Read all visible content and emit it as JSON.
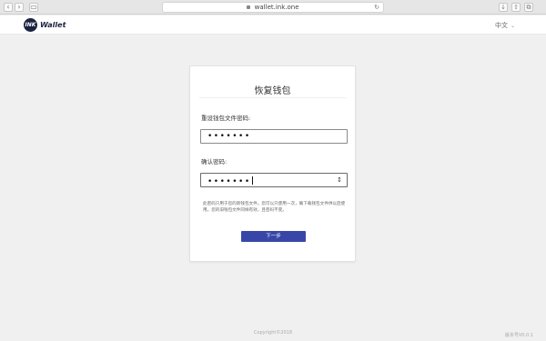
{
  "browser": {
    "url": "wallet.ink.one",
    "back": "‹",
    "forward": "›",
    "sidebar": "▭",
    "reload": "↻",
    "share": "⇧",
    "tabs": "⧉",
    "download": "↓",
    "icons": [
      "lock-icon",
      "reload-icon",
      "share-icon",
      "tabs-icon",
      "download-icon"
    ]
  },
  "header": {
    "logo_mark": "INK",
    "logo_text": "Wallet",
    "language": "中文",
    "chevron": "⌄"
  },
  "card": {
    "title": "恢复钱包",
    "reset_label": "重设钱包文件密码:",
    "reset_value": "•••••••",
    "confirm_label": "确认密码:",
    "confirm_value": "•••••••",
    "eye_icon_glyph": "👁",
    "note": "此密码只用于您的新钱包文件。您可以只使用一次，确下载钱包文件供以后使用。您的旧钱包文件同样有效，且密码不变。",
    "next_button": "下一步"
  },
  "footer": {
    "copyright": "Copyright©2018",
    "version": "版本号V0.0.1"
  }
}
